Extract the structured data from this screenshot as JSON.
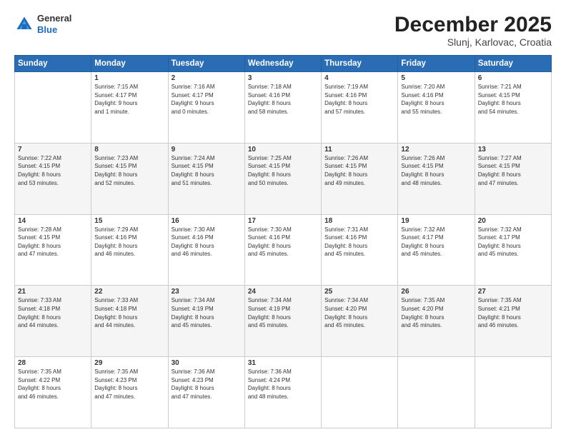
{
  "header": {
    "logo_line1": "General",
    "logo_line2": "Blue",
    "month": "December 2025",
    "location": "Slunj, Karlovac, Croatia"
  },
  "weekdays": [
    "Sunday",
    "Monday",
    "Tuesday",
    "Wednesday",
    "Thursday",
    "Friday",
    "Saturday"
  ],
  "weeks": [
    [
      {
        "day": "",
        "text": ""
      },
      {
        "day": "1",
        "text": "Sunrise: 7:15 AM\nSunset: 4:17 PM\nDaylight: 9 hours\nand 1 minute."
      },
      {
        "day": "2",
        "text": "Sunrise: 7:16 AM\nSunset: 4:17 PM\nDaylight: 9 hours\nand 0 minutes."
      },
      {
        "day": "3",
        "text": "Sunrise: 7:18 AM\nSunset: 4:16 PM\nDaylight: 8 hours\nand 58 minutes."
      },
      {
        "day": "4",
        "text": "Sunrise: 7:19 AM\nSunset: 4:16 PM\nDaylight: 8 hours\nand 57 minutes."
      },
      {
        "day": "5",
        "text": "Sunrise: 7:20 AM\nSunset: 4:16 PM\nDaylight: 8 hours\nand 55 minutes."
      },
      {
        "day": "6",
        "text": "Sunrise: 7:21 AM\nSunset: 4:15 PM\nDaylight: 8 hours\nand 54 minutes."
      }
    ],
    [
      {
        "day": "7",
        "text": "Sunrise: 7:22 AM\nSunset: 4:15 PM\nDaylight: 8 hours\nand 53 minutes."
      },
      {
        "day": "8",
        "text": "Sunrise: 7:23 AM\nSunset: 4:15 PM\nDaylight: 8 hours\nand 52 minutes."
      },
      {
        "day": "9",
        "text": "Sunrise: 7:24 AM\nSunset: 4:15 PM\nDaylight: 8 hours\nand 51 minutes."
      },
      {
        "day": "10",
        "text": "Sunrise: 7:25 AM\nSunset: 4:15 PM\nDaylight: 8 hours\nand 50 minutes."
      },
      {
        "day": "11",
        "text": "Sunrise: 7:26 AM\nSunset: 4:15 PM\nDaylight: 8 hours\nand 49 minutes."
      },
      {
        "day": "12",
        "text": "Sunrise: 7:26 AM\nSunset: 4:15 PM\nDaylight: 8 hours\nand 48 minutes."
      },
      {
        "day": "13",
        "text": "Sunrise: 7:27 AM\nSunset: 4:15 PM\nDaylight: 8 hours\nand 47 minutes."
      }
    ],
    [
      {
        "day": "14",
        "text": "Sunrise: 7:28 AM\nSunset: 4:15 PM\nDaylight: 8 hours\nand 47 minutes."
      },
      {
        "day": "15",
        "text": "Sunrise: 7:29 AM\nSunset: 4:16 PM\nDaylight: 8 hours\nand 46 minutes."
      },
      {
        "day": "16",
        "text": "Sunrise: 7:30 AM\nSunset: 4:16 PM\nDaylight: 8 hours\nand 46 minutes."
      },
      {
        "day": "17",
        "text": "Sunrise: 7:30 AM\nSunset: 4:16 PM\nDaylight: 8 hours\nand 45 minutes."
      },
      {
        "day": "18",
        "text": "Sunrise: 7:31 AM\nSunset: 4:16 PM\nDaylight: 8 hours\nand 45 minutes."
      },
      {
        "day": "19",
        "text": "Sunrise: 7:32 AM\nSunset: 4:17 PM\nDaylight: 8 hours\nand 45 minutes."
      },
      {
        "day": "20",
        "text": "Sunrise: 7:32 AM\nSunset: 4:17 PM\nDaylight: 8 hours\nand 45 minutes."
      }
    ],
    [
      {
        "day": "21",
        "text": "Sunrise: 7:33 AM\nSunset: 4:18 PM\nDaylight: 8 hours\nand 44 minutes."
      },
      {
        "day": "22",
        "text": "Sunrise: 7:33 AM\nSunset: 4:18 PM\nDaylight: 8 hours\nand 44 minutes."
      },
      {
        "day": "23",
        "text": "Sunrise: 7:34 AM\nSunset: 4:19 PM\nDaylight: 8 hours\nand 45 minutes."
      },
      {
        "day": "24",
        "text": "Sunrise: 7:34 AM\nSunset: 4:19 PM\nDaylight: 8 hours\nand 45 minutes."
      },
      {
        "day": "25",
        "text": "Sunrise: 7:34 AM\nSunset: 4:20 PM\nDaylight: 8 hours\nand 45 minutes."
      },
      {
        "day": "26",
        "text": "Sunrise: 7:35 AM\nSunset: 4:20 PM\nDaylight: 8 hours\nand 45 minutes."
      },
      {
        "day": "27",
        "text": "Sunrise: 7:35 AM\nSunset: 4:21 PM\nDaylight: 8 hours\nand 46 minutes."
      }
    ],
    [
      {
        "day": "28",
        "text": "Sunrise: 7:35 AM\nSunset: 4:22 PM\nDaylight: 8 hours\nand 46 minutes."
      },
      {
        "day": "29",
        "text": "Sunrise: 7:35 AM\nSunset: 4:23 PM\nDaylight: 8 hours\nand 47 minutes."
      },
      {
        "day": "30",
        "text": "Sunrise: 7:36 AM\nSunset: 4:23 PM\nDaylight: 8 hours\nand 47 minutes."
      },
      {
        "day": "31",
        "text": "Sunrise: 7:36 AM\nSunset: 4:24 PM\nDaylight: 8 hours\nand 48 minutes."
      },
      {
        "day": "",
        "text": ""
      },
      {
        "day": "",
        "text": ""
      },
      {
        "day": "",
        "text": ""
      }
    ]
  ]
}
